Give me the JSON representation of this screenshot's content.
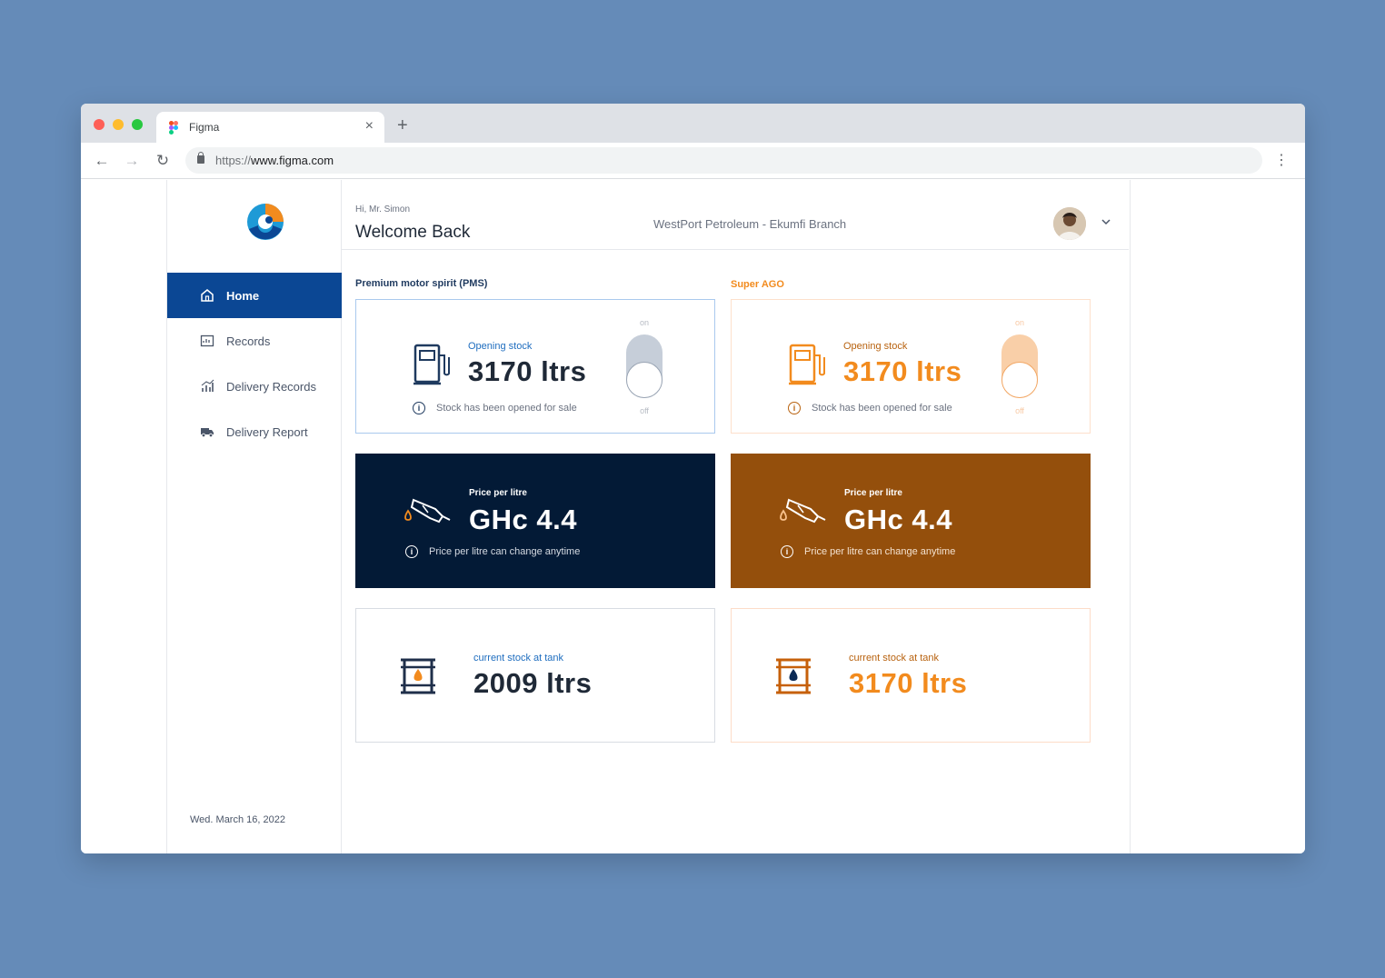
{
  "browser": {
    "tab_title": "Figma",
    "tab_close": "×",
    "new_tab": "+",
    "url_protocol": "https://",
    "url_host": "www.figma.com",
    "back": "←",
    "forward": "→",
    "reload": "↻",
    "menu": "⋮"
  },
  "sidebar": {
    "items": [
      {
        "label": "Home",
        "icon": "home-icon",
        "active": true
      },
      {
        "label": "Records",
        "icon": "records-icon",
        "active": false
      },
      {
        "label": "Delivery Records",
        "icon": "chart-icon",
        "active": false
      },
      {
        "label": "Delivery Report",
        "icon": "truck-icon",
        "active": false
      }
    ],
    "date": "Wed. March 16, 2022"
  },
  "header": {
    "greeting": "Hi, Mr. Simon",
    "title": "Welcome Back",
    "branch": "WestPort Petroleum - Ekumfi Branch"
  },
  "colors": {
    "primary": "#0b4794",
    "navy": "#031a36",
    "orange": "#f28b1e",
    "brown": "#944f0c"
  },
  "pms": {
    "section_label": "Premium motor spirit (PMS)",
    "opening_label": "Opening stock",
    "opening_value": "3170 ltrs",
    "opening_note": "Stock has been opened for sale",
    "toggle_on": "on",
    "toggle_off": "off",
    "price_label": "Price per litre",
    "price_value": "GHc 4.4",
    "price_note": "Price per litre can change anytime",
    "tank_label": "current stock at tank",
    "tank_value": "2009 ltrs"
  },
  "ago": {
    "section_label": "Super AGO",
    "opening_label": "Opening stock",
    "opening_value": "3170 ltrs",
    "opening_note": "Stock has been opened for sale",
    "toggle_on": "on",
    "toggle_off": "off",
    "price_label": "Price per litre",
    "price_value": "GHc 4.4",
    "price_note": "Price per litre can change anytime",
    "tank_label": "current stock at tank",
    "tank_value": "3170 ltrs"
  }
}
